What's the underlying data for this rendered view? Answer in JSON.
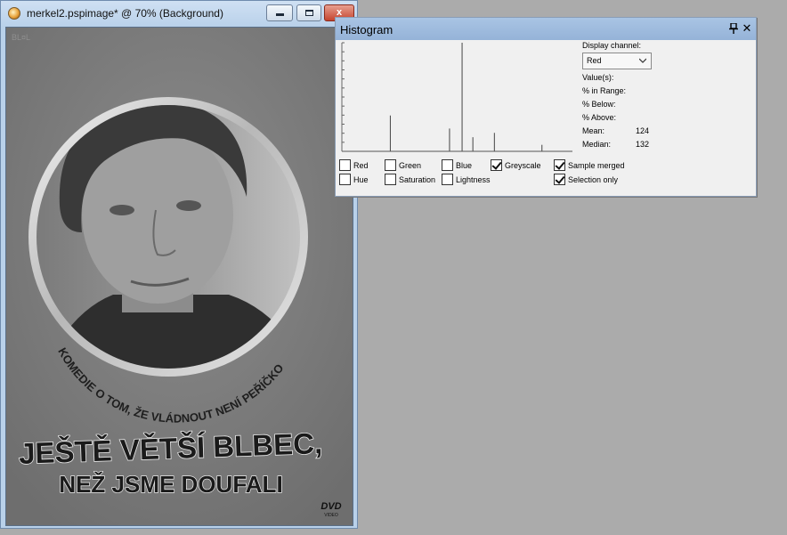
{
  "document": {
    "title": "merkel2.pspimage* @  70% (Background)",
    "window_buttons": {
      "minimize": "",
      "maximize": "",
      "close": "x"
    },
    "poster": {
      "corner_mark": "BL¤L",
      "subtitle": "KOMEDIE O TOM, ŽE VLÁDNOUT NENÍ PEŘÍČKO",
      "title_line1": "JEŠTĚ VĚTŠÍ BLBEC,",
      "title_line2": "NEŽ JSME DOUFALI",
      "dvd_logo": "DVD",
      "dvd_sub": "VIDEO"
    }
  },
  "histogram": {
    "title": "Histogram",
    "display_channel_label": "Display channel:",
    "display_channel_value": "Red",
    "stats": {
      "values_label": "Value(s):",
      "in_range_label": "% in Range:",
      "below_label": "% Below:",
      "above_label": "% Above:",
      "mean_label": "Mean:",
      "mean_value": "124",
      "median_label": "Median:",
      "median_value": "132"
    },
    "checkboxes": {
      "red": {
        "label": "Red",
        "checked": false
      },
      "green": {
        "label": "Green",
        "checked": false
      },
      "blue": {
        "label": "Blue",
        "checked": false
      },
      "greyscale": {
        "label": "Greyscale",
        "checked": true
      },
      "sample_merged": {
        "label": "Sample merged",
        "checked": true
      },
      "hue": {
        "label": "Hue",
        "checked": false
      },
      "saturation": {
        "label": "Saturation",
        "checked": false
      },
      "lightness": {
        "label": "Lightness",
        "checked": false
      },
      "selection_only": {
        "label": "Selection only",
        "checked": true
      }
    },
    "bars": [
      {
        "level": 54,
        "height": 0.33
      },
      {
        "level": 120,
        "height": 0.21
      },
      {
        "level": 134,
        "height": 1.0
      },
      {
        "level": 146,
        "height": 0.13
      },
      {
        "level": 170,
        "height": 0.17
      },
      {
        "level": 223,
        "height": 0.06
      }
    ]
  },
  "colors": {
    "workspace_bg": "#ababab",
    "titlebar_active": "#b9d1ea",
    "panel_title": "#98b6db",
    "close_red": "#c4442e"
  }
}
